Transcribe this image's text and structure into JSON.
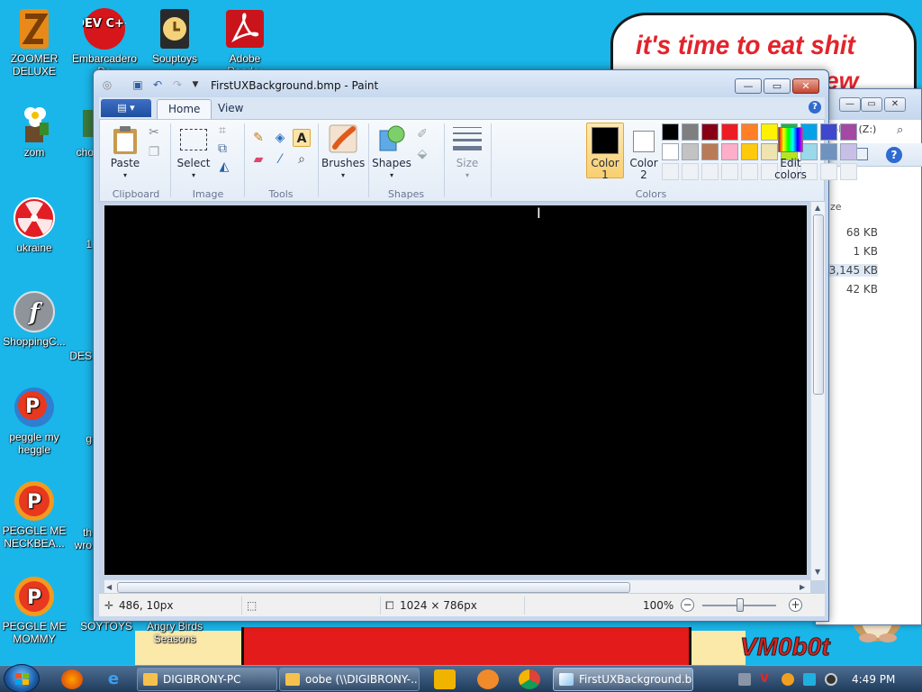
{
  "wallpaper": {
    "speech_line1": "it's time to eat shit",
    "speech_line2": "ew",
    "logo": "VM0b0t"
  },
  "desktop_icons": [
    {
      "label": "ZOOMER DELUXE",
      "icon": "zoomer-icon"
    },
    {
      "label": "DEV C++",
      "icon": "devcpp-icon"
    },
    {
      "label": "Embarcadero De",
      "icon": "embarcadero-icon"
    },
    {
      "label": "Souptoys",
      "icon": "souptoys-icon"
    },
    {
      "label": "Adobe Reader",
      "icon": "adobe-reader-icon"
    },
    {
      "label": "zom",
      "icon": "flower-icon"
    },
    {
      "label": "cho",
      "icon": "cho-icon"
    },
    {
      "label": "ukraine",
      "icon": "radiation-icon"
    },
    {
      "label": "ShoppingC...",
      "icon": "flash-icon"
    },
    {
      "label": "peggle my heggle",
      "icon": "peggle-icon"
    },
    {
      "label": "PEGGLE ME NECKBEA...",
      "icon": "peggle-icon"
    },
    {
      "label": "PEGGLE ME MOMMY",
      "icon": "peggle-icon"
    },
    {
      "label": "SOYTOYS",
      "icon": "soytoys-icon"
    },
    {
      "label": "Angry Birds Seasons",
      "icon": "angry-birds-icon"
    },
    {
      "label": "1",
      "icon": "partial-icon"
    },
    {
      "label": "DES",
      "icon": "partial-icon"
    },
    {
      "label": "g",
      "icon": "partial-icon"
    },
    {
      "label": "th wro",
      "icon": "partial-icon"
    }
  ],
  "explorer": {
    "path_fragment": "Y-PC) (Z:)",
    "column_header": "ze",
    "sizes": [
      "68 KB",
      "1 KB",
      "3,145 KB",
      "42 KB"
    ]
  },
  "paint": {
    "title": "FirstUXBackground.bmp - Paint",
    "window_controls": {
      "minimize": "—",
      "maximize": "▭",
      "close": "✕"
    },
    "tabs": [
      {
        "label": "Home",
        "active": true
      },
      {
        "label": "View",
        "active": false
      }
    ],
    "ribbon": {
      "paste_label": "Paste",
      "select_label": "Select",
      "brushes_label": "Brushes",
      "shapes_label": "Shapes",
      "size_label": "Size",
      "color1_label": "Color 1",
      "color2_label": "Color 2",
      "edit_colors_label": "Edit colors",
      "groups": {
        "clipboard": "Clipboard",
        "image": "Image",
        "tools": "Tools",
        "shapes": "Shapes",
        "colors": "Colors"
      },
      "palette_row1": [
        "#000000",
        "#7f7f7f",
        "#880015",
        "#ed1c24",
        "#ff7f27",
        "#fff200",
        "#22b14c",
        "#00a2e8",
        "#3f48cc",
        "#a349a4"
      ],
      "palette_row2": [
        "#ffffff",
        "#c3c3c3",
        "#b97a57",
        "#ffaec9",
        "#ffc90e",
        "#efe4b0",
        "#b5e61d",
        "#99d9ea",
        "#7092be",
        "#c8bfe7"
      ],
      "color1_value": "#000000",
      "color2_value": "#ffffff"
    },
    "status": {
      "cursor_pos": "486, 10px",
      "image_size": "1024 × 786px",
      "zoom": "100%"
    }
  },
  "taskbar": {
    "tasks": [
      {
        "label": "DIGIBRONY-PC",
        "active": false
      },
      {
        "label": "oobe (\\\\DIGIBRONY-...",
        "active": false
      },
      {
        "label": "FirstUXBackground.b...",
        "active": true
      }
    ],
    "clock": "4:49 PM"
  }
}
